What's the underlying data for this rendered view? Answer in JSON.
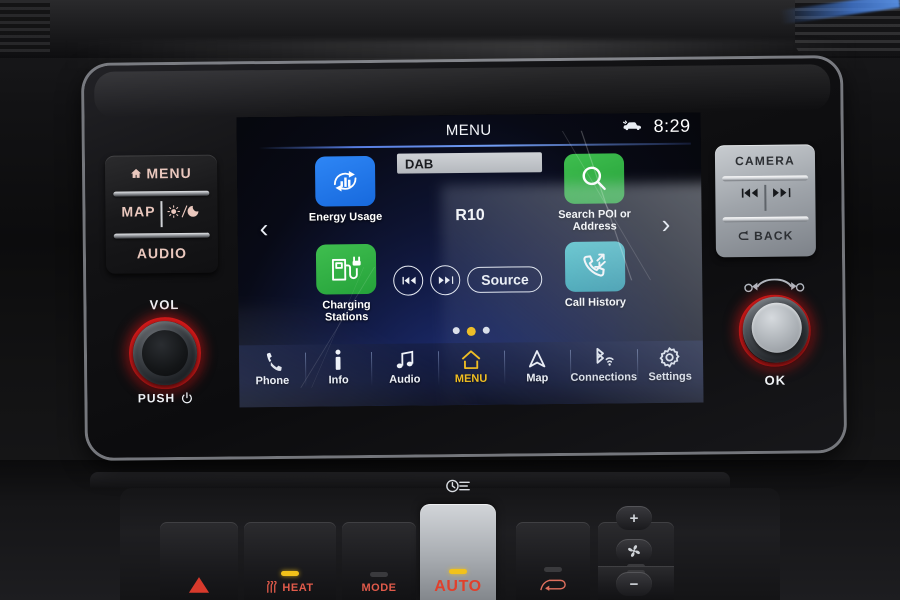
{
  "device": {
    "type": "car-infotainment-head-unit",
    "brand_hint": "Nissan Leaf NissanConnect"
  },
  "screen": {
    "header": {
      "title": "MENU",
      "time": "8:29",
      "status_icon": "car-indicator-icon"
    },
    "tiles": [
      {
        "id": "energy-usage",
        "label": "Energy Usage",
        "icon": "energy-usage-icon",
        "color": "#2e86f5"
      },
      {
        "id": "charging-stations",
        "label": "Charging\nStations",
        "label_line1": "Charging",
        "label_line2": "Stations",
        "icon": "charging-station-icon",
        "color": "#3fbe4f"
      },
      {
        "id": "search-poi",
        "label_line1": "Search POI or",
        "label_line2": "Address",
        "icon": "search-icon",
        "color": "#3fbe4f"
      },
      {
        "id": "call-history",
        "label_line1": "Call History",
        "label_line2": "",
        "icon": "call-history-icon",
        "color": "#4fc5cc"
      }
    ],
    "media": {
      "source": "DAB",
      "station": "R10",
      "prev_icon": "previous-track-icon",
      "next_icon": "next-track-icon",
      "source_button": "Source"
    },
    "pager": {
      "left_arrow": "‹",
      "right_arrow": "›",
      "dots": 3,
      "active_index": 1
    },
    "nav": [
      {
        "id": "phone",
        "label": "Phone",
        "icon": "phone-icon",
        "active": false
      },
      {
        "id": "info",
        "label": "Info",
        "icon": "info-icon",
        "active": false
      },
      {
        "id": "audio",
        "label": "Audio",
        "icon": "music-note-icon",
        "active": false
      },
      {
        "id": "menu",
        "label": "MENU",
        "icon": "home-icon",
        "active": true
      },
      {
        "id": "map",
        "label": "Map",
        "icon": "navigation-arrow-icon",
        "active": false
      },
      {
        "id": "connections",
        "label": "Connections",
        "icon": "bluetooth-wifi-icon",
        "active": false
      },
      {
        "id": "settings",
        "label": "Settings",
        "icon": "gear-icon",
        "active": false
      }
    ],
    "accent_color": "#f5bf18"
  },
  "hard_buttons": {
    "left_panel": {
      "menu": "MENU",
      "menu_icon": "home-icon",
      "map": "MAP",
      "daynight_icon": "sun-moon-icon",
      "audio": "AUDIO"
    },
    "right_panel": {
      "camera": "CAMERA",
      "prev_icon": "previous-track-icon",
      "next_icon": "next-track-icon",
      "back": "BACK",
      "back_icon": "back-arrow-icon"
    },
    "volume_knob": {
      "label": "VOL",
      "sub_label": "PUSH",
      "power_icon": "power-icon",
      "ring_color": "#e11919"
    },
    "ok_knob": {
      "label": "OK",
      "top_icon": "tune-scroll-icon",
      "ring_color": "#e11919"
    }
  },
  "climate": {
    "hazard": {
      "icon": "hazard-triangle-icon",
      "label": ""
    },
    "seat_heat": {
      "label": "HEAT",
      "icon": "seat-heat-icon",
      "indicator": "on"
    },
    "mode": {
      "label": "MODE",
      "icon": "",
      "indicator": "off"
    },
    "auto": {
      "label": "AUTO",
      "icon": "timer-light-icon",
      "indicator": "on"
    },
    "recirculate": {
      "icon": "recirculate-icon",
      "indicator": "off"
    },
    "defrost_front": {
      "icon": "front-defrost-icon",
      "indicator": "off"
    },
    "defrost_rear": {
      "icon": "rear-defrost-icon",
      "indicator": "off"
    },
    "fan_up": {
      "icon": "plus-icon"
    },
    "fan": {
      "icon": "fan-icon"
    },
    "fan_down": {
      "icon": "minus-icon"
    }
  }
}
